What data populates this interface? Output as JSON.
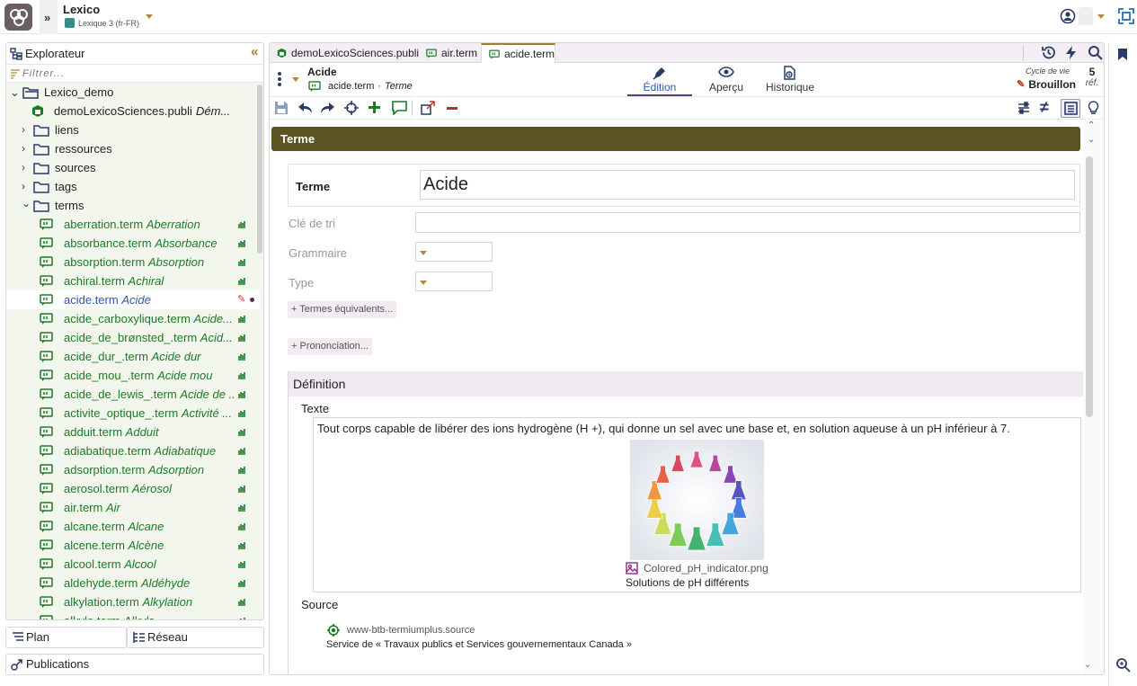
{
  "app": {
    "title": "Lexico",
    "subtitle": "Lexique 3 (fr-FR)"
  },
  "explorer": {
    "title": "Explorateur",
    "filter_placeholder": "Filtrer...",
    "root": "Lexico_demo",
    "publi": {
      "name": "demoLexicoSciences.publi",
      "title": "Dém..."
    },
    "folders": [
      "liens",
      "ressources",
      "sources",
      "tags",
      "terms"
    ],
    "terms": [
      {
        "file": "aberration.term",
        "label": "Aberration"
      },
      {
        "file": "absorbance.term",
        "label": "Absorbance"
      },
      {
        "file": "absorption.term",
        "label": "Absorption"
      },
      {
        "file": "achiral.term",
        "label": "Achiral"
      },
      {
        "file": "acide.term",
        "label": "Acide"
      },
      {
        "file": "acide_carboxylique.term",
        "label": "Acide..."
      },
      {
        "file": "acide_de_brønsted_.term",
        "label": "Acid..."
      },
      {
        "file": "acide_dur_.term",
        "label": "Acide dur"
      },
      {
        "file": "acide_mou_.term",
        "label": "Acide mou"
      },
      {
        "file": "acide_de_lewis_.term",
        "label": "Acide de ..."
      },
      {
        "file": "activite_optique_.term",
        "label": "Activité ..."
      },
      {
        "file": "adduit.term",
        "label": "Adduit"
      },
      {
        "file": "adiabatique.term",
        "label": "Adiabatique"
      },
      {
        "file": "adsorption.term",
        "label": "Adsorption"
      },
      {
        "file": "aerosol.term",
        "label": "Aérosol"
      },
      {
        "file": "air.term",
        "label": "Air"
      },
      {
        "file": "alcane.term",
        "label": "Alcane"
      },
      {
        "file": "alcene.term",
        "label": "Alcène"
      },
      {
        "file": "alcool.term",
        "label": "Alcool"
      },
      {
        "file": "aldehyde.term",
        "label": "Aldéhyde"
      },
      {
        "file": "alkylation.term",
        "label": "Alkylation"
      },
      {
        "file": "alkyle.term",
        "label": "Alkyle"
      }
    ],
    "bottom": {
      "plan": "Plan",
      "reseau": "Réseau",
      "publications": "Publications"
    }
  },
  "tabs": [
    {
      "label": "demoLexicoSciences.publi"
    },
    {
      "label": "air.term"
    },
    {
      "label": "acide.term"
    }
  ],
  "doc": {
    "title": "Acide",
    "path": "acide.term",
    "path_sep": " · ",
    "type": "Terme",
    "views": {
      "edition": "Édition",
      "apercu": "Aperçu",
      "historique": "Historique"
    },
    "lifecycle_label": "Cycle de vie",
    "lifecycle_value": "Brouillon",
    "refs_count": "5",
    "refs_label": "réf."
  },
  "form": {
    "section_title": "Terme",
    "terme_label": "Terme",
    "terme_value": "Acide",
    "cle_label": "Clé de tri",
    "grammaire_label": "Grammaire",
    "type_label": "Type",
    "add_equiv": "+ Termes équivalents...",
    "add_pron": "+ Prononciation...",
    "definition_title": "Définition",
    "texte_label": "Texte",
    "definition_text": "Tout corps capable de libérer des ions hydrogène (H +), qui donne un sel avec une base et, en solution aqueuse à un pH inférieur à 7.",
    "image_file": "Colored_pH_indicator.png",
    "image_caption": "Solutions de pH différents",
    "source_label": "Source",
    "source_file": "www-btb-termiumplus.source",
    "source_desc": "Service de « Travaux publics et Services gouvernementaux Canada »"
  },
  "colors": {
    "accent": "#a37d2a",
    "section_bar": "#5b5420",
    "term_green": "#1c7a28",
    "folder_navy": "#2b3a67",
    "active_blue": "#2f56b0"
  }
}
